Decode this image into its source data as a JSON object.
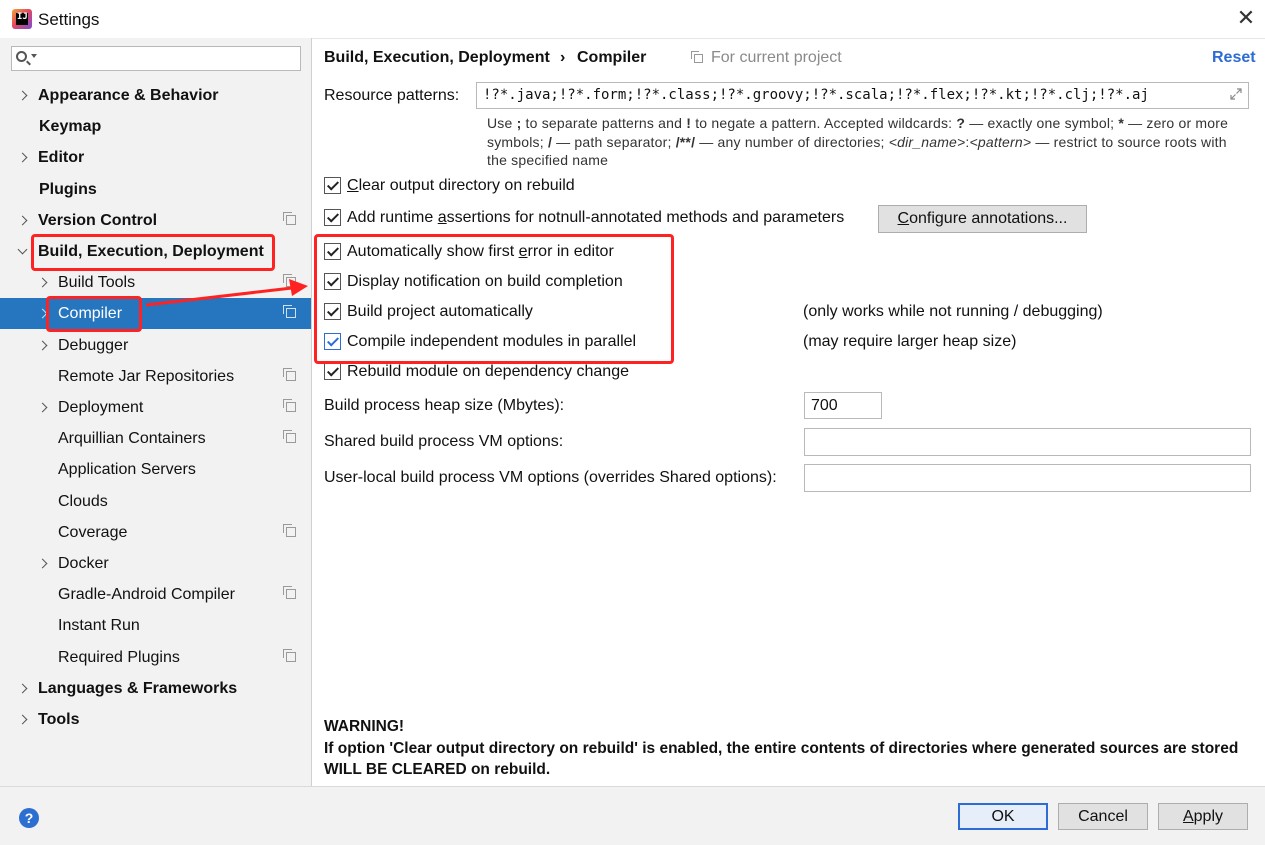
{
  "window": {
    "title": "Settings",
    "app_icon": "IJ"
  },
  "search": {
    "placeholder": ""
  },
  "sidebar": {
    "items": [
      {
        "label": "Appearance & Behavior",
        "bold": true,
        "arrow": "right",
        "proj": false
      },
      {
        "label": "Keymap",
        "bold": true,
        "arrow": "",
        "proj": false
      },
      {
        "label": "Editor",
        "bold": true,
        "arrow": "right",
        "proj": false
      },
      {
        "label": "Plugins",
        "bold": true,
        "arrow": "",
        "proj": false
      },
      {
        "label": "Version Control",
        "bold": true,
        "arrow": "right",
        "proj": true
      },
      {
        "label": "Build, Execution, Deployment",
        "bold": true,
        "arrow": "down",
        "proj": false
      },
      {
        "label": "Build Tools",
        "bold": false,
        "arrow": "right",
        "proj": true
      },
      {
        "label": "Compiler",
        "bold": false,
        "arrow": "right",
        "proj": true,
        "selected": true
      },
      {
        "label": "Debugger",
        "bold": false,
        "arrow": "right",
        "proj": false
      },
      {
        "label": "Remote Jar Repositories",
        "bold": false,
        "arrow": "",
        "proj": true
      },
      {
        "label": "Deployment",
        "bold": false,
        "arrow": "right",
        "proj": true
      },
      {
        "label": "Arquillian Containers",
        "bold": false,
        "arrow": "",
        "proj": true
      },
      {
        "label": "Application Servers",
        "bold": false,
        "arrow": "",
        "proj": false
      },
      {
        "label": "Clouds",
        "bold": false,
        "arrow": "",
        "proj": false
      },
      {
        "label": "Coverage",
        "bold": false,
        "arrow": "",
        "proj": true
      },
      {
        "label": "Docker",
        "bold": false,
        "arrow": "right",
        "proj": false
      },
      {
        "label": "Gradle-Android Compiler",
        "bold": false,
        "arrow": "",
        "proj": true
      },
      {
        "label": "Instant Run",
        "bold": false,
        "arrow": "",
        "proj": false
      },
      {
        "label": "Required Plugins",
        "bold": false,
        "arrow": "",
        "proj": true
      },
      {
        "label": "Languages & Frameworks",
        "bold": true,
        "arrow": "right",
        "proj": false
      },
      {
        "label": "Tools",
        "bold": true,
        "arrow": "right",
        "proj": false
      }
    ]
  },
  "header": {
    "breadcrumb_parent": "Build, Execution, Deployment",
    "breadcrumb_sep": "›",
    "breadcrumb_current": "Compiler",
    "scope": "For current project",
    "reset": "Reset"
  },
  "compiler": {
    "resource_patterns_label": "Resource patterns:",
    "resource_patterns_value": "!?*.java;!?*.form;!?*.class;!?*.groovy;!?*.scala;!?*.flex;!?*.kt;!?*.clj;!?*.aj",
    "help": {
      "p1": "Use ",
      "b1": ";",
      "p2": " to separate patterns and ",
      "b2": "!",
      "p3": " to negate a pattern. Accepted wildcards: ",
      "b3": "?",
      "p4": " — exactly one symbol; ",
      "b4": "*",
      "p5": " — zero or more symbols; ",
      "b5": "/",
      "p6": " — path separator; ",
      "b6": "/**/",
      "p7": " — any number of directories; ",
      "i1": "<dir_name>",
      "p8": ":",
      "i2": "<pattern>",
      "p9": " — restrict to source roots with the specified name"
    },
    "checkboxes": [
      {
        "pre": "",
        "mn": "C",
        "post": "lear output directory on rebuild",
        "checked": true
      },
      {
        "pre": "Add runtime ",
        "mn": "a",
        "post": "ssertions for notnull-annotated methods and parameters",
        "checked": true
      },
      {
        "pre": "Automatically show first ",
        "mn": "e",
        "post": "rror in editor",
        "checked": true
      },
      {
        "pre": "Display notification on build completion",
        "mn": "",
        "post": "",
        "checked": true
      },
      {
        "pre": "Build project automatically",
        "mn": "",
        "post": "",
        "checked": true
      },
      {
        "pre": "Compile independent modules in parallel",
        "mn": "",
        "post": "",
        "checked": true
      },
      {
        "pre": "Rebuild module on dependency change",
        "mn": "",
        "post": "",
        "checked": true
      }
    ],
    "configure_button": {
      "mn": "C",
      "rest": "onfigure annotations..."
    },
    "note_build_auto": "(only works while not running / debugging)",
    "note_parallel": "(may require larger heap size)",
    "heap_label": "Build process heap size (Mbytes):",
    "heap_value": "700",
    "shared_vm_label": "Shared build process VM options:",
    "shared_vm_value": "",
    "local_vm_label": "User-local build process VM options (overrides Shared options):",
    "local_vm_value": "",
    "warning_title": "WARNING!",
    "warning_text": "If option 'Clear output directory on rebuild' is enabled, the entire contents of directories where generated sources are stored WILL BE CLEARED on rebuild."
  },
  "footer": {
    "help": "?",
    "ok": "OK",
    "cancel": "Cancel",
    "apply_mn": "A",
    "apply_rest": "pply"
  },
  "colors": {
    "accent": "#2c6cd4",
    "selection": "#2675bf",
    "annotation": "#ff2222"
  }
}
